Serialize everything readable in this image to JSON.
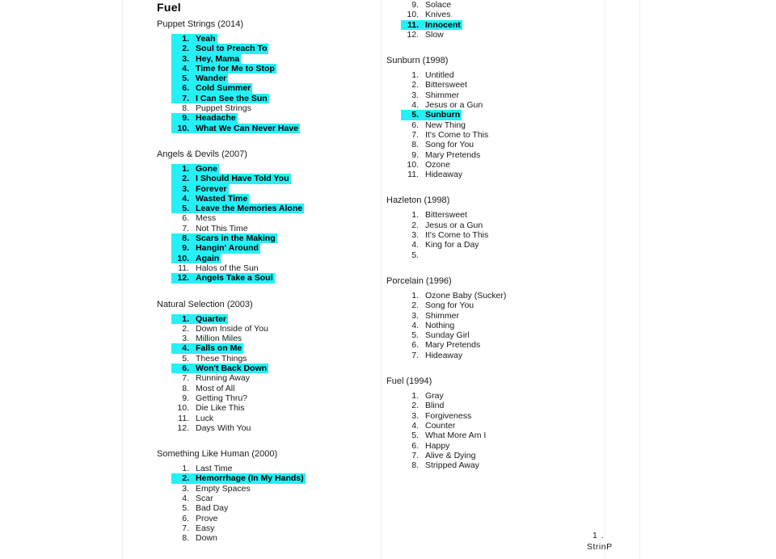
{
  "document": {
    "title": "Fuel",
    "footer_number": "1 .",
    "footer_word": "StrinP"
  },
  "left_column": [
    {
      "album": "Puppet Strings (2014)",
      "tracks": [
        {
          "n": "1.",
          "t": "Yeah",
          "hl": true
        },
        {
          "n": "2.",
          "t": "Soul to Preach To",
          "hl": true
        },
        {
          "n": "3.",
          "t": "Hey, Mama",
          "hl": true
        },
        {
          "n": "4.",
          "t": "Time for Me to Stop",
          "hl": true
        },
        {
          "n": "5.",
          "t": "Wander",
          "hl": true
        },
        {
          "n": "6.",
          "t": "Cold Summer",
          "hl": true
        },
        {
          "n": "7.",
          "t": "I Can See the Sun",
          "hl": true
        },
        {
          "n": "8.",
          "t": "Puppet Strings",
          "hl": false
        },
        {
          "n": "9.",
          "t": "Headache",
          "hl": true
        },
        {
          "n": "10.",
          "t": "What We Can Never Have",
          "hl": true
        }
      ]
    },
    {
      "album": "Angels & Devils (2007)",
      "tracks": [
        {
          "n": "1.",
          "t": "Gone",
          "hl": true
        },
        {
          "n": "2.",
          "t": "I Should Have Told You",
          "hl": true
        },
        {
          "n": "3.",
          "t": "Forever",
          "hl": true
        },
        {
          "n": "4.",
          "t": "Wasted Time",
          "hl": true
        },
        {
          "n": "5.",
          "t": "Leave the Memories Alone",
          "hl": true
        },
        {
          "n": "6.",
          "t": "Mess",
          "hl": false
        },
        {
          "n": "7.",
          "t": "Not This Time",
          "hl": false
        },
        {
          "n": "8.",
          "t": "Scars in the Making",
          "hl": true
        },
        {
          "n": "9.",
          "t": "Hangin' Around",
          "hl": true
        },
        {
          "n": "10.",
          "t": "Again",
          "hl": true
        },
        {
          "n": "11.",
          "t": "Halos of the Sun",
          "hl": false
        },
        {
          "n": "12.",
          "t": "Angels Take a Soul",
          "hl": true
        }
      ]
    },
    {
      "album": "Natural Selection (2003)",
      "tracks": [
        {
          "n": "1.",
          "t": "Quarter",
          "hl": true
        },
        {
          "n": "2.",
          "t": "Down Inside of You",
          "hl": false
        },
        {
          "n": "3.",
          "t": "Million Miles",
          "hl": false
        },
        {
          "n": "4.",
          "t": "Falls on Me",
          "hl": true
        },
        {
          "n": "5.",
          "t": "These Things",
          "hl": false
        },
        {
          "n": "6.",
          "t": "Won't Back Down",
          "hl": true
        },
        {
          "n": "7.",
          "t": "Running Away",
          "hl": false
        },
        {
          "n": "8.",
          "t": "Most of All",
          "hl": false
        },
        {
          "n": "9.",
          "t": "Getting Thru?",
          "hl": false
        },
        {
          "n": "10.",
          "t": "Die Like This",
          "hl": false
        },
        {
          "n": "11.",
          "t": "Luck",
          "hl": false
        },
        {
          "n": "12.",
          "t": "Days With You",
          "hl": false
        }
      ]
    },
    {
      "album": "Something Like Human (2000)",
      "tracks": [
        {
          "n": "1.",
          "t": "Last Time",
          "hl": false
        },
        {
          "n": "2.",
          "t": "Hemorrhage (In My Hands)",
          "hl": true
        },
        {
          "n": "3.",
          "t": "Empty Spaces",
          "hl": false
        },
        {
          "n": "4.",
          "t": "Scar",
          "hl": false
        },
        {
          "n": "5.",
          "t": "Bad Day",
          "hl": false
        },
        {
          "n": "6.",
          "t": "Prove",
          "hl": false
        },
        {
          "n": "7.",
          "t": "Easy",
          "hl": false
        },
        {
          "n": "8.",
          "t": "Down",
          "hl": false
        }
      ]
    }
  ],
  "right_column": [
    {
      "album": "",
      "tracks": [
        {
          "n": "9.",
          "t": "Solace",
          "hl": false
        },
        {
          "n": "10.",
          "t": "Knives",
          "hl": false
        },
        {
          "n": "11.",
          "t": "Innocent",
          "hl": true
        },
        {
          "n": "12.",
          "t": "Slow",
          "hl": false
        }
      ]
    },
    {
      "album": "Sunburn (1998)",
      "tracks": [
        {
          "n": "1.",
          "t": "Untitled",
          "hl": false
        },
        {
          "n": "2.",
          "t": "Bittersweet",
          "hl": false
        },
        {
          "n": "3.",
          "t": "Shimmer",
          "hl": false
        },
        {
          "n": "4.",
          "t": "Jesus or a Gun",
          "hl": false
        },
        {
          "n": "5.",
          "t": "Sunburn",
          "hl": true
        },
        {
          "n": "6.",
          "t": "New Thing",
          "hl": false
        },
        {
          "n": "7.",
          "t": "It's Come to This",
          "hl": false
        },
        {
          "n": "8.",
          "t": "Song for You",
          "hl": false
        },
        {
          "n": "9.",
          "t": "Mary Pretends",
          "hl": false
        },
        {
          "n": "10.",
          "t": "Ozone",
          "hl": false
        },
        {
          "n": "11.",
          "t": "Hideaway",
          "hl": false
        }
      ]
    },
    {
      "album": "Hazleton (1998)",
      "tracks": [
        {
          "n": "1.",
          "t": "Bittersweet",
          "hl": false
        },
        {
          "n": "2.",
          "t": "Jesus or a Gun",
          "hl": false
        },
        {
          "n": "3.",
          "t": "It's Come to This",
          "hl": false
        },
        {
          "n": "4.",
          "t": "King for a Day",
          "hl": false
        },
        {
          "n": "5.",
          "t": "",
          "hl": false
        }
      ]
    },
    {
      "album": "Porcelain (1996)",
      "tracks": [
        {
          "n": "1.",
          "t": "Ozone Baby (Sucker)",
          "hl": false
        },
        {
          "n": "2.",
          "t": "Song for You",
          "hl": false
        },
        {
          "n": "3.",
          "t": "Shimmer",
          "hl": false
        },
        {
          "n": "4.",
          "t": "Nothing",
          "hl": false
        },
        {
          "n": "5.",
          "t": "Sunday Girl",
          "hl": false
        },
        {
          "n": "6.",
          "t": "Mary Pretends",
          "hl": false
        },
        {
          "n": "7.",
          "t": "Hideaway",
          "hl": false
        }
      ]
    },
    {
      "album": "Fuel (1994)",
      "tracks": [
        {
          "n": "1.",
          "t": "Gray",
          "hl": false
        },
        {
          "n": "2.",
          "t": "Blind",
          "hl": false
        },
        {
          "n": "3.",
          "t": "Forgiveness",
          "hl": false
        },
        {
          "n": "4.",
          "t": "Counter",
          "hl": false
        },
        {
          "n": "5.",
          "t": "What More Am I",
          "hl": false
        },
        {
          "n": "6.",
          "t": "Happy",
          "hl": false
        },
        {
          "n": "7.",
          "t": "Alive & Dying",
          "hl": false
        },
        {
          "n": "8.",
          "t": "Stripped Away",
          "hl": false
        }
      ]
    }
  ]
}
